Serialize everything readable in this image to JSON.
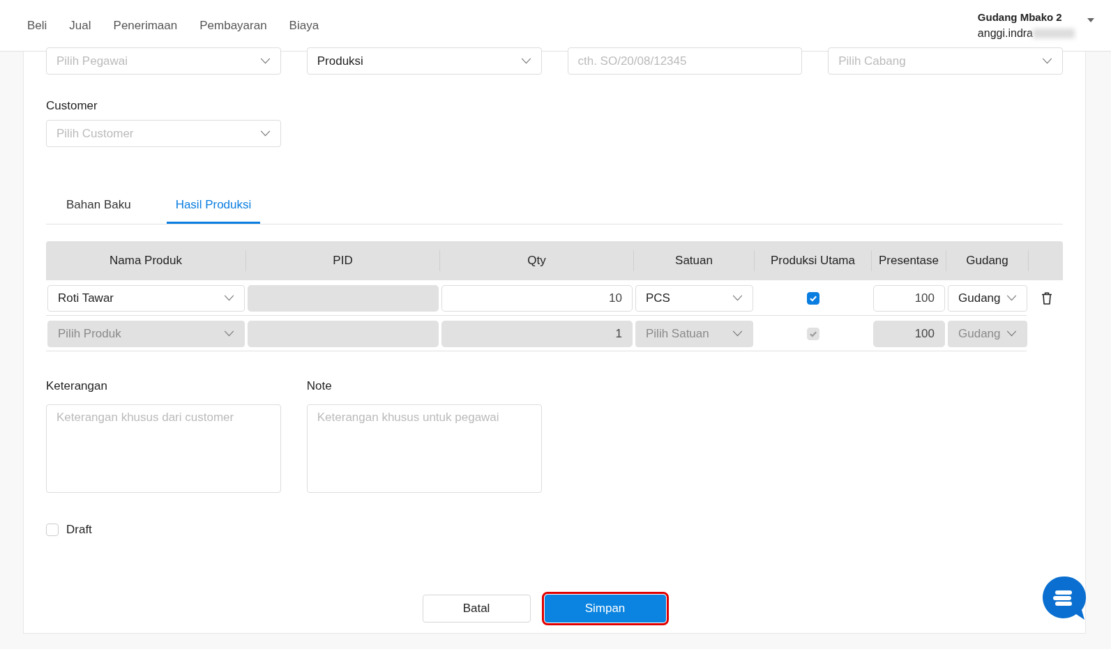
{
  "nav": {
    "items": [
      {
        "label": "Beli",
        "selected": false
      },
      {
        "label": "Jual",
        "selected": false
      },
      {
        "label": "Penerimaan",
        "selected": false
      },
      {
        "label": "Pembayaran",
        "selected": false
      },
      {
        "label": "Biaya",
        "selected": false
      }
    ]
  },
  "account": {
    "company": "Gudang Mbako 2",
    "user": "anggi.indra",
    "redacted": true
  },
  "top_fields": [
    {
      "kind": "select",
      "placeholder": "Pilih Pegawai"
    },
    {
      "kind": "select",
      "value": "Produksi"
    },
    {
      "kind": "text",
      "placeholder": "cth. SO/20/08/12345"
    },
    {
      "kind": "select",
      "placeholder": "Pilih Cabang"
    }
  ],
  "customer": {
    "label": "Customer",
    "placeholder": "Pilih Customer"
  },
  "tabs": [
    {
      "label": "Bahan Baku",
      "selected": false
    },
    {
      "label": "Hasil Produksi",
      "selected": true
    }
  ],
  "table": {
    "columns": [
      "Nama Produk",
      "PID",
      "Qty",
      "Satuan",
      "Produksi Utama",
      "Presentase",
      "Gudang"
    ],
    "rows": [
      {
        "product": "Roti Tawar",
        "qty": "10",
        "unit": "PCS",
        "main": true,
        "percentage": "100",
        "warehouse": "Gudang",
        "disabled": false,
        "deletable": true
      },
      {
        "product_placeholder": "Pilih Produk",
        "qty": "1",
        "unit_placeholder": "Pilih Satuan",
        "main": true,
        "percentage": "100",
        "warehouse": "Gudang",
        "disabled": true,
        "deletable": false
      }
    ]
  },
  "notes": [
    {
      "label": "Keterangan",
      "placeholder": "Keterangan khusus dari customer"
    },
    {
      "label": "Note",
      "placeholder": "Keterangan khusus untuk pegawai"
    }
  ],
  "draft": {
    "label": "Draft",
    "checked": false
  },
  "buttons": [
    {
      "label": "Batal",
      "kind": "secondary",
      "highlighted": false
    },
    {
      "label": "Simpan",
      "kind": "primary",
      "highlighted": true
    }
  ]
}
